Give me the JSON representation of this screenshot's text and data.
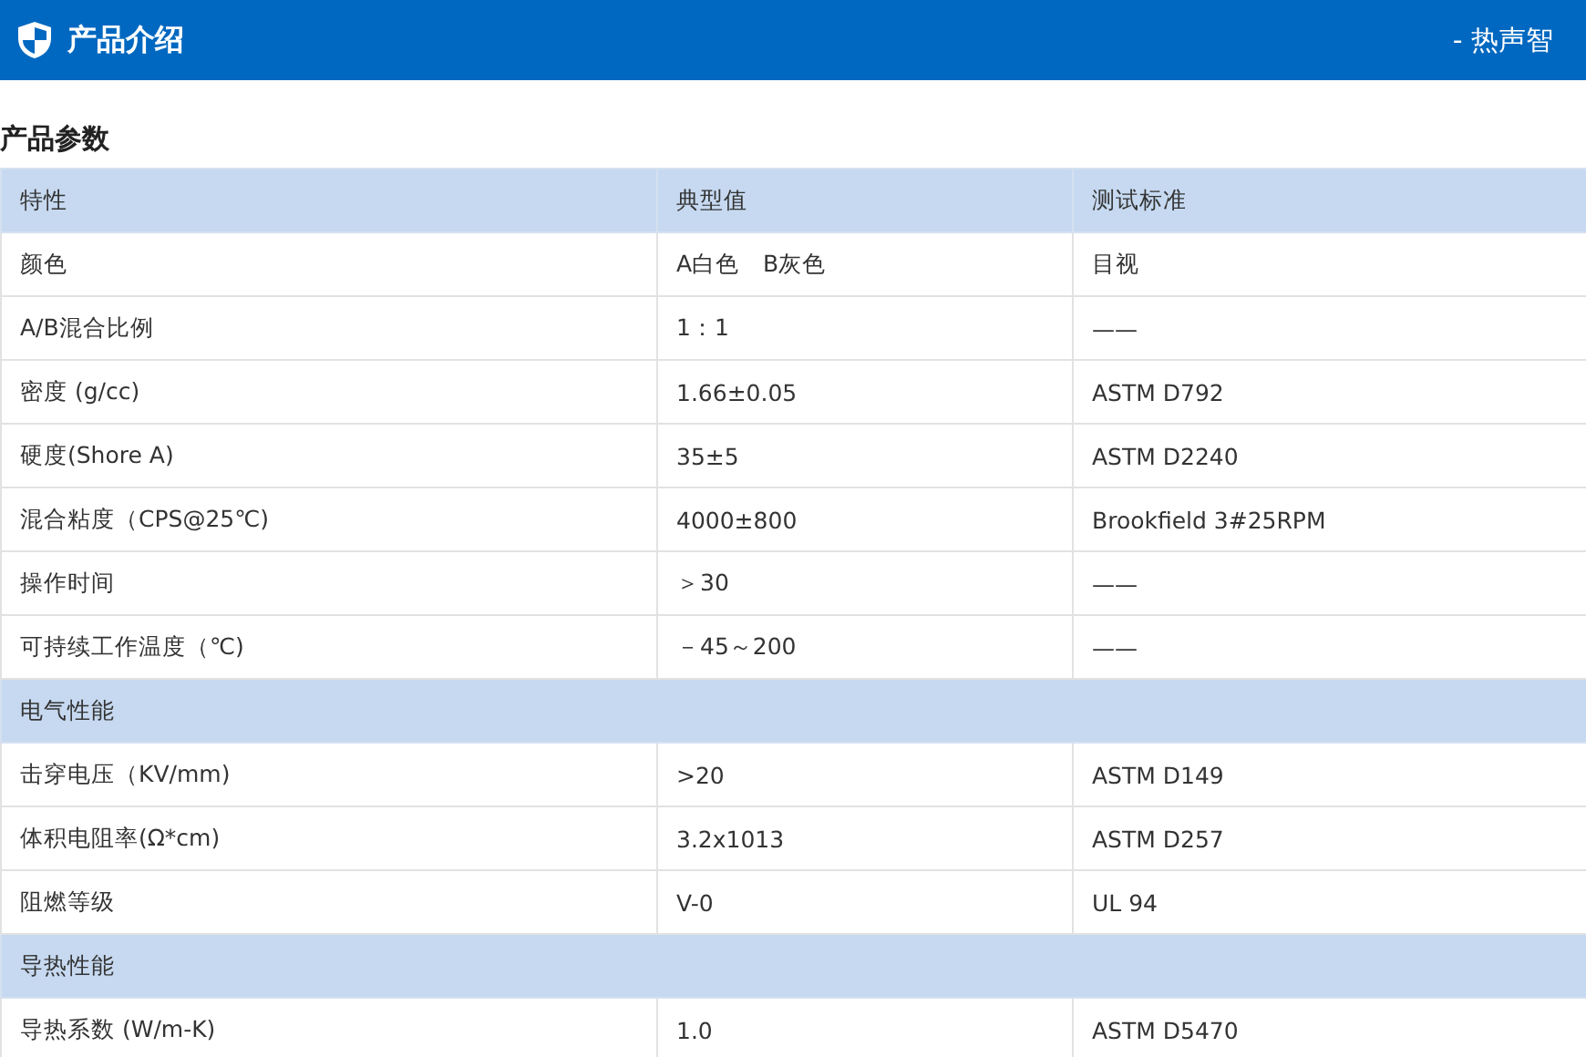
{
  "header": {
    "title": "产品介绍",
    "tagline": "- 热声智"
  },
  "section_title": "产品参数",
  "table": {
    "rows": [
      {
        "kind": "header",
        "cells": [
          "特性",
          "典型值",
          "测试标准"
        ]
      },
      {
        "kind": "data",
        "cells": [
          "颜色",
          "A白色　B灰色",
          "目视"
        ]
      },
      {
        "kind": "data",
        "cells": [
          "A/B混合比例",
          "1：1",
          "——"
        ]
      },
      {
        "kind": "data",
        "cells": [
          "密度 (g/cc)",
          "1.66±0.05",
          "ASTM D792"
        ]
      },
      {
        "kind": "data",
        "cells": [
          "硬度(Shore A)",
          "35±5",
          "ASTM D2240"
        ]
      },
      {
        "kind": "data",
        "cells": [
          "混合粘度（CPS@25℃)",
          "4000±800",
          "Brookfield 3#25RPM"
        ]
      },
      {
        "kind": "data",
        "cells": [
          "操作时间",
          "＞30",
          "——"
        ]
      },
      {
        "kind": "data",
        "cells": [
          "可持续工作温度（℃)",
          "－45～200",
          "——"
        ]
      },
      {
        "kind": "section",
        "cells": [
          "电气性能"
        ]
      },
      {
        "kind": "data",
        "cells": [
          "击穿电压（KV/mm)",
          ">20",
          "ASTM D149"
        ]
      },
      {
        "kind": "data",
        "cells": [
          "体积电阻率(Ω*cm)",
          "3.2x1013",
          "ASTM D257"
        ]
      },
      {
        "kind": "data",
        "cells": [
          "阻燃等级",
          "V-0",
          "UL 94"
        ]
      },
      {
        "kind": "section",
        "cells": [
          "导热性能"
        ]
      },
      {
        "kind": "data",
        "cells": [
          "导热系数 (W/m-K)",
          "1.0",
          "ASTM D5470"
        ]
      }
    ]
  }
}
